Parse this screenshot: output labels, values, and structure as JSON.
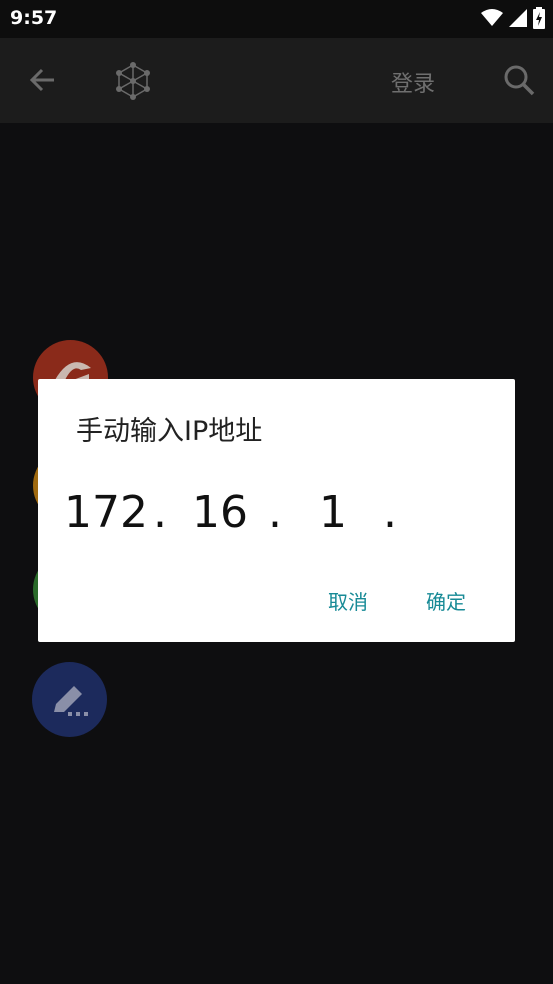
{
  "status_bar": {
    "time": "9:57"
  },
  "app_bar": {
    "login_label": "登录"
  },
  "dialog": {
    "title": "手动输入IP地址",
    "ip": {
      "seg1": "172",
      "seg2": "16",
      "seg3": "1",
      "seg4": "",
      "dot": "."
    },
    "cancel_label": "取消",
    "confirm_label": "确定"
  },
  "colors": {
    "accent": "#178a96",
    "fab_red": "#8a2a1a",
    "fab_orange": "#a06a10",
    "fab_green": "#2a6a2a",
    "fab_blue": "#1c2a5c"
  }
}
